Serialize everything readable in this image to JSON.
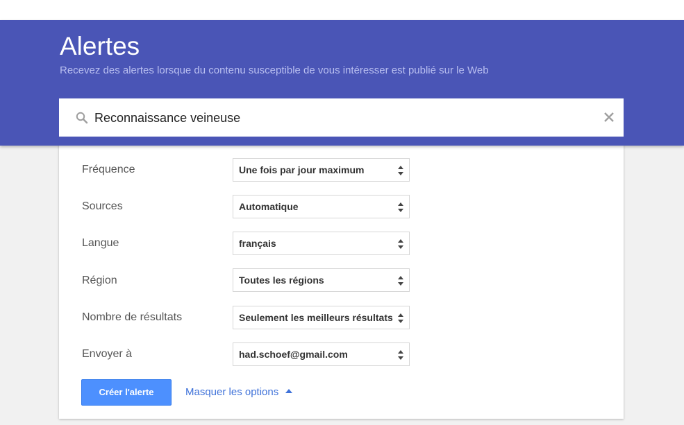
{
  "header": {
    "title": "Alertes",
    "subtitle": "Recevez des alertes lorsque du contenu susceptible de vous intéresser est publié sur le Web",
    "background_color": "#4a55b6"
  },
  "search": {
    "icon": "search-icon",
    "query": "Reconnaissance veineuse",
    "clear_icon": "close-icon"
  },
  "options": [
    {
      "label": "Fréquence",
      "value": "Une fois par jour maximum"
    },
    {
      "label": "Sources",
      "value": "Automatique"
    },
    {
      "label": "Langue",
      "value": "français"
    },
    {
      "label": "Région",
      "value": "Toutes les régions"
    },
    {
      "label": "Nombre de résultats",
      "value": "Seulement les meilleurs résultats"
    },
    {
      "label": "Envoyer à",
      "value": "had.schoef@gmail.com"
    }
  ],
  "actions": {
    "create_label": "Créer l'alerte",
    "create_color": "#4d90fe",
    "hide_options_label": "Masquer les options",
    "hide_options_icon": "caret-up-icon",
    "link_color": "#3f72d9"
  }
}
